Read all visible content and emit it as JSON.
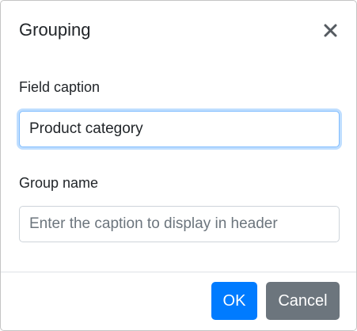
{
  "dialog": {
    "title": "Grouping",
    "close_icon": "close-icon"
  },
  "field_caption": {
    "label": "Field caption",
    "value": "Product category"
  },
  "group_name": {
    "label": "Group name",
    "value": "",
    "placeholder": "Enter the caption to display in header"
  },
  "footer": {
    "ok_label": "OK",
    "cancel_label": "Cancel"
  },
  "colors": {
    "primary": "#007bff",
    "secondary": "#6c757d",
    "focus_border": "#80bdff"
  }
}
